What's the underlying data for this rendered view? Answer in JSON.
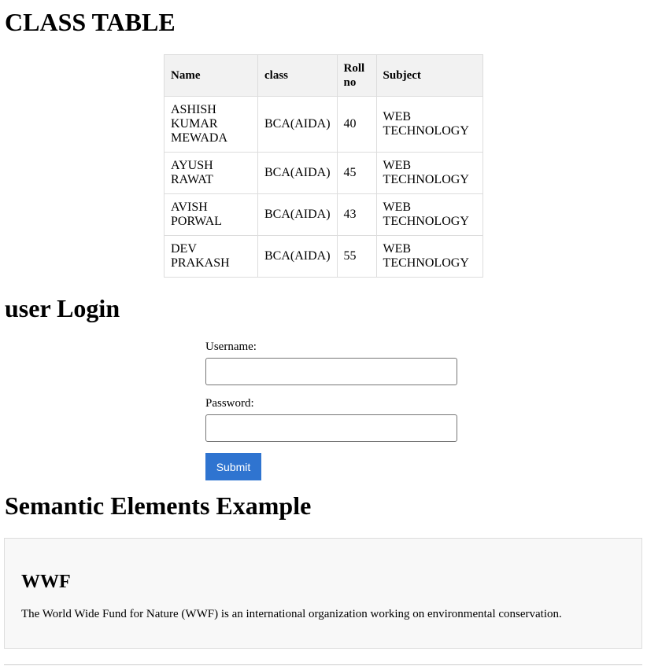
{
  "class_table": {
    "title": "CLASS TABLE",
    "headers": [
      "Name",
      "class",
      "Roll no",
      "Subject"
    ],
    "rows": [
      [
        "ASHISH KUMAR MEWADA",
        "BCA(AIDA)",
        "40",
        "WEB TECHNOLOGY"
      ],
      [
        "AYUSH RAWAT",
        "BCA(AIDA)",
        "45",
        "WEB TECHNOLOGY"
      ],
      [
        "AVISH PORWAL",
        "BCA(AIDA)",
        "43",
        "WEB TECHNOLOGY"
      ],
      [
        "DEV PRAKASH",
        "BCA(AIDA)",
        "55",
        "WEB TECHNOLOGY"
      ]
    ]
  },
  "login": {
    "title": "user Login",
    "username_label": "Username:",
    "username_value": "",
    "password_label": "Password:",
    "password_value": "",
    "submit_label": "Submit",
    "submit_color": "#2f74d0"
  },
  "semantic": {
    "title": "Semantic Elements Example",
    "article_heading": "WWF",
    "article_text": "The World Wide Fund for Nature (WWF) is an international organization working on environmental conservation."
  }
}
